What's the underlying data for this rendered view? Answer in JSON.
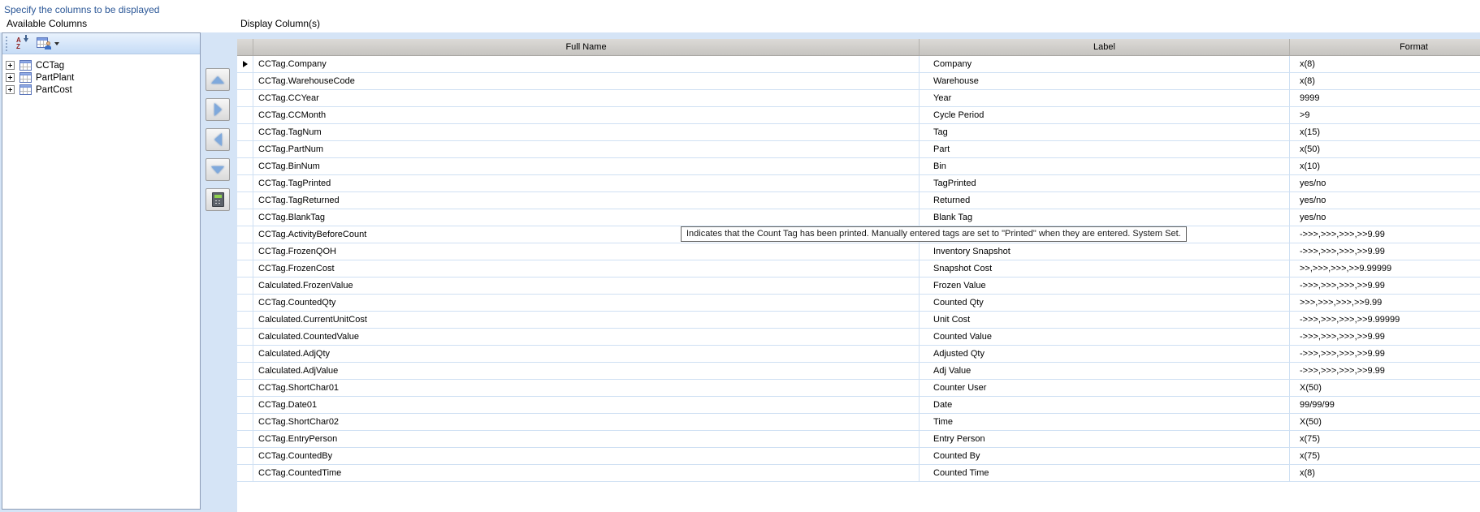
{
  "header": {
    "instruction": "Specify the columns to be displayed"
  },
  "left_panel": {
    "title": "Available Columns",
    "toolbar": {
      "icons": [
        {
          "name": "sort-az-icon"
        },
        {
          "name": "column-chooser-icon"
        },
        {
          "name": "dropdown-caret-icon"
        }
      ]
    },
    "tree": [
      {
        "label": "CCTag",
        "expanded": false
      },
      {
        "label": "PartPlant",
        "expanded": false
      },
      {
        "label": "PartCost",
        "expanded": false
      }
    ]
  },
  "transfer_buttons": [
    {
      "name": "move-up-button",
      "icon": "triangle-up-icon",
      "kind": "tri-up"
    },
    {
      "name": "move-right-button",
      "icon": "triangle-right-icon",
      "kind": "tri-right"
    },
    {
      "name": "move-left-button",
      "icon": "triangle-left-icon",
      "kind": "tri-left"
    },
    {
      "name": "move-down-button",
      "icon": "triangle-down-icon",
      "kind": "tri-down"
    },
    {
      "name": "calculator-button",
      "icon": "calculator-icon",
      "kind": "calc"
    }
  ],
  "table": {
    "title": "Display Column(s)",
    "columns": [
      "Full Name",
      "Label",
      "Format"
    ],
    "current_row_index": 0,
    "rows": [
      {
        "full_name": "CCTag.Company",
        "label": "Company",
        "format": "x(8)"
      },
      {
        "full_name": "CCTag.WarehouseCode",
        "label": "Warehouse",
        "format": "x(8)"
      },
      {
        "full_name": "CCTag.CCYear",
        "label": "Year",
        "format": "9999"
      },
      {
        "full_name": "CCTag.CCMonth",
        "label": "Cycle Period",
        "format": ">9"
      },
      {
        "full_name": "CCTag.TagNum",
        "label": "Tag",
        "format": "x(15)"
      },
      {
        "full_name": "CCTag.PartNum",
        "label": "Part",
        "format": "x(50)"
      },
      {
        "full_name": "CCTag.BinNum",
        "label": "Bin",
        "format": "x(10)"
      },
      {
        "full_name": "CCTag.TagPrinted",
        "label": "TagPrinted",
        "format": "yes/no"
      },
      {
        "full_name": "CCTag.TagReturned",
        "label": "Returned",
        "format": "yes/no"
      },
      {
        "full_name": "CCTag.BlankTag",
        "label": "Blank Tag",
        "format": "yes/no"
      },
      {
        "full_name": "CCTag.ActivityBeforeCount",
        "label": "",
        "format": "->>>,>>>,>>>,>>9.99"
      },
      {
        "full_name": "CCTag.FrozenQOH",
        "label": "Inventory Snapshot",
        "format": "->>>,>>>,>>>,>>9.99"
      },
      {
        "full_name": "CCTag.FrozenCost",
        "label": "Snapshot Cost",
        "format": ">>,>>>,>>>,>>9.99999"
      },
      {
        "full_name": "Calculated.FrozenValue",
        "label": "Frozen Value",
        "format": "->>>,>>>,>>>,>>9.99"
      },
      {
        "full_name": "CCTag.CountedQty",
        "label": "Counted Qty",
        "format": ">>>,>>>,>>>,>>9.99"
      },
      {
        "full_name": "Calculated.CurrentUnitCost",
        "label": "Unit Cost",
        "format": "->>>,>>>,>>>,>>9.99999"
      },
      {
        "full_name": "Calculated.CountedValue",
        "label": "Counted Value",
        "format": "->>>,>>>,>>>,>>9.99"
      },
      {
        "full_name": "Calculated.AdjQty",
        "label": "Adjusted Qty",
        "format": "->>>,>>>,>>>,>>9.99"
      },
      {
        "full_name": "Calculated.AdjValue",
        "label": "Adj Value",
        "format": "->>>,>>>,>>>,>>9.99"
      },
      {
        "full_name": "CCTag.ShortChar01",
        "label": "Counter User",
        "format": "X(50)"
      },
      {
        "full_name": "CCTag.Date01",
        "label": "Date",
        "format": "99/99/99"
      },
      {
        "full_name": "CCTag.ShortChar02",
        "label": "Time",
        "format": "X(50)"
      },
      {
        "full_name": "CCTag.EntryPerson",
        "label": "Entry Person",
        "format": "x(75)"
      },
      {
        "full_name": "CCTag.CountedBy",
        "label": "Counted By",
        "format": "x(75)"
      },
      {
        "full_name": "CCTag.CountedTime",
        "label": "Counted Time",
        "format": "x(8)"
      }
    ]
  },
  "tooltip": {
    "text": "Indicates that the Count Tag has been printed.  Manually entered tags are set to \"Printed\" when they are entered.  System Set."
  },
  "colors": {
    "instruction_text": "#2b5797",
    "panel_blue": "#d5e4f6",
    "grid_line": "#cfe0f3",
    "header_grey": "#c6c4c0"
  }
}
